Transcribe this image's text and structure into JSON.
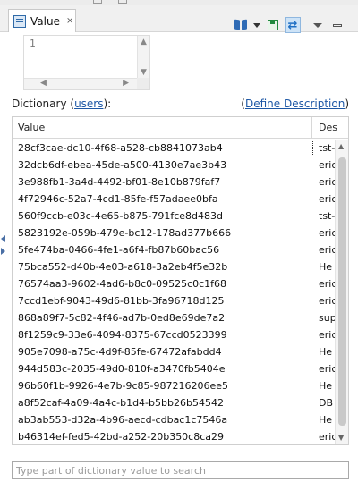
{
  "tab": {
    "label": "Value",
    "close_glyph": "⨯",
    "icon": "value-view-icon"
  },
  "toolbar": {
    "icons": [
      "dictionary-book-icon",
      "dropdown-caret-icon",
      "save-icon",
      "swap-icon",
      "view-menu-icon",
      "minimize-icon"
    ]
  },
  "editor": {
    "line_number": "1"
  },
  "dictionary": {
    "label": "Dictionary",
    "owner_link": "users",
    "colon": "):",
    "open_paren": "(",
    "define_link": "Define Description",
    "define_open": "(",
    "define_close": ")"
  },
  "table": {
    "columns": [
      "Value",
      "Des"
    ],
    "rows": [
      {
        "value": "28cf3cae-dc10-4f68-a528-cb8841073ab4",
        "desc": "tst-"
      },
      {
        "value": "32dcb6df-ebea-45de-a500-4130e7ae3b43",
        "desc": "eric"
      },
      {
        "value": "3e988fb1-3a4d-4492-bf01-8e10b879faf7",
        "desc": "eric"
      },
      {
        "value": "4f72946c-52a7-4cd1-85fe-f57adaee0bfa",
        "desc": "eric"
      },
      {
        "value": "560f9ccb-e03c-4e65-b875-791fce8d483d",
        "desc": "tst-"
      },
      {
        "value": "5823192e-059b-479e-bc12-178ad377b666",
        "desc": "eric"
      },
      {
        "value": "5fe474ba-0466-4fe1-a6f4-fb87b60bac56",
        "desc": "eric"
      },
      {
        "value": "75bca552-d40b-4e03-a618-3a2eb4f5e32b",
        "desc": "He"
      },
      {
        "value": "76574aa3-9602-4ad6-b8c0-09525c0c1f68",
        "desc": "eric"
      },
      {
        "value": "7ccd1ebf-9043-49d6-81bb-3fa96718d125",
        "desc": "eric"
      },
      {
        "value": "868a89f7-5c82-4f46-ad7b-0ed8e69de7a2",
        "desc": "sup"
      },
      {
        "value": "8f1259c9-33e6-4094-8375-67ccd0523399",
        "desc": "eric"
      },
      {
        "value": "905e7098-a75c-4d9f-85fe-67472afabdd4",
        "desc": "He"
      },
      {
        "value": "944d583c-2035-49d0-810f-a3470fb5404e",
        "desc": "eric"
      },
      {
        "value": "96b60f1b-9926-4e7b-9c85-987216206ee5",
        "desc": "He"
      },
      {
        "value": "a8f52caf-4a09-4a4c-b1d4-b5bb26b54542",
        "desc": "DB"
      },
      {
        "value": "ab3ab553-d32a-4b96-aecd-cdbac1c7546a",
        "desc": "He"
      },
      {
        "value": "b46314ef-fed5-42bd-a252-20b350c8ca29",
        "desc": "eric"
      }
    ]
  },
  "search": {
    "placeholder": "Type part of dictionary value to search",
    "value": ""
  }
}
